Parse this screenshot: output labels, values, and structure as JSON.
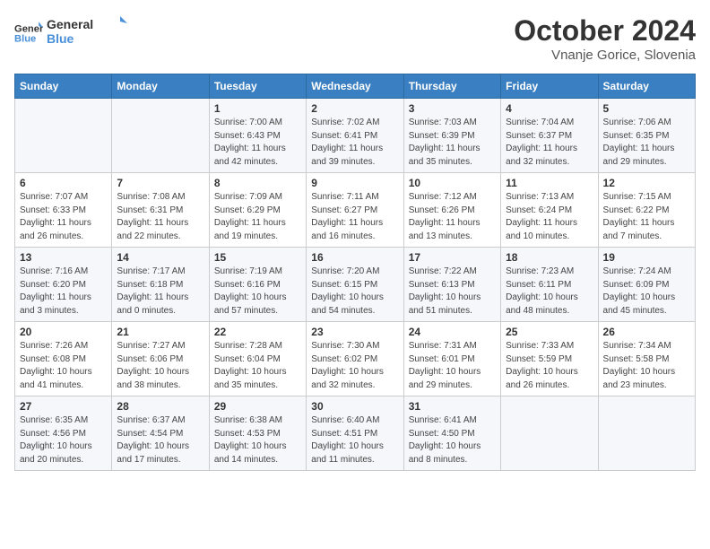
{
  "header": {
    "logo_general": "General",
    "logo_blue": "Blue",
    "month_title": "October 2024",
    "location": "Vnanje Gorice, Slovenia"
  },
  "weekdays": [
    "Sunday",
    "Monday",
    "Tuesday",
    "Wednesday",
    "Thursday",
    "Friday",
    "Saturday"
  ],
  "weeks": [
    [
      {
        "day": "",
        "info": ""
      },
      {
        "day": "",
        "info": ""
      },
      {
        "day": "1",
        "info": "Sunrise: 7:00 AM\nSunset: 6:43 PM\nDaylight: 11 hours and 42 minutes."
      },
      {
        "day": "2",
        "info": "Sunrise: 7:02 AM\nSunset: 6:41 PM\nDaylight: 11 hours and 39 minutes."
      },
      {
        "day": "3",
        "info": "Sunrise: 7:03 AM\nSunset: 6:39 PM\nDaylight: 11 hours and 35 minutes."
      },
      {
        "day": "4",
        "info": "Sunrise: 7:04 AM\nSunset: 6:37 PM\nDaylight: 11 hours and 32 minutes."
      },
      {
        "day": "5",
        "info": "Sunrise: 7:06 AM\nSunset: 6:35 PM\nDaylight: 11 hours and 29 minutes."
      }
    ],
    [
      {
        "day": "6",
        "info": "Sunrise: 7:07 AM\nSunset: 6:33 PM\nDaylight: 11 hours and 26 minutes."
      },
      {
        "day": "7",
        "info": "Sunrise: 7:08 AM\nSunset: 6:31 PM\nDaylight: 11 hours and 22 minutes."
      },
      {
        "day": "8",
        "info": "Sunrise: 7:09 AM\nSunset: 6:29 PM\nDaylight: 11 hours and 19 minutes."
      },
      {
        "day": "9",
        "info": "Sunrise: 7:11 AM\nSunset: 6:27 PM\nDaylight: 11 hours and 16 minutes."
      },
      {
        "day": "10",
        "info": "Sunrise: 7:12 AM\nSunset: 6:26 PM\nDaylight: 11 hours and 13 minutes."
      },
      {
        "day": "11",
        "info": "Sunrise: 7:13 AM\nSunset: 6:24 PM\nDaylight: 11 hours and 10 minutes."
      },
      {
        "day": "12",
        "info": "Sunrise: 7:15 AM\nSunset: 6:22 PM\nDaylight: 11 hours and 7 minutes."
      }
    ],
    [
      {
        "day": "13",
        "info": "Sunrise: 7:16 AM\nSunset: 6:20 PM\nDaylight: 11 hours and 3 minutes."
      },
      {
        "day": "14",
        "info": "Sunrise: 7:17 AM\nSunset: 6:18 PM\nDaylight: 11 hours and 0 minutes."
      },
      {
        "day": "15",
        "info": "Sunrise: 7:19 AM\nSunset: 6:16 PM\nDaylight: 10 hours and 57 minutes."
      },
      {
        "day": "16",
        "info": "Sunrise: 7:20 AM\nSunset: 6:15 PM\nDaylight: 10 hours and 54 minutes."
      },
      {
        "day": "17",
        "info": "Sunrise: 7:22 AM\nSunset: 6:13 PM\nDaylight: 10 hours and 51 minutes."
      },
      {
        "day": "18",
        "info": "Sunrise: 7:23 AM\nSunset: 6:11 PM\nDaylight: 10 hours and 48 minutes."
      },
      {
        "day": "19",
        "info": "Sunrise: 7:24 AM\nSunset: 6:09 PM\nDaylight: 10 hours and 45 minutes."
      }
    ],
    [
      {
        "day": "20",
        "info": "Sunrise: 7:26 AM\nSunset: 6:08 PM\nDaylight: 10 hours and 41 minutes."
      },
      {
        "day": "21",
        "info": "Sunrise: 7:27 AM\nSunset: 6:06 PM\nDaylight: 10 hours and 38 minutes."
      },
      {
        "day": "22",
        "info": "Sunrise: 7:28 AM\nSunset: 6:04 PM\nDaylight: 10 hours and 35 minutes."
      },
      {
        "day": "23",
        "info": "Sunrise: 7:30 AM\nSunset: 6:02 PM\nDaylight: 10 hours and 32 minutes."
      },
      {
        "day": "24",
        "info": "Sunrise: 7:31 AM\nSunset: 6:01 PM\nDaylight: 10 hours and 29 minutes."
      },
      {
        "day": "25",
        "info": "Sunrise: 7:33 AM\nSunset: 5:59 PM\nDaylight: 10 hours and 26 minutes."
      },
      {
        "day": "26",
        "info": "Sunrise: 7:34 AM\nSunset: 5:58 PM\nDaylight: 10 hours and 23 minutes."
      }
    ],
    [
      {
        "day": "27",
        "info": "Sunrise: 6:35 AM\nSunset: 4:56 PM\nDaylight: 10 hours and 20 minutes."
      },
      {
        "day": "28",
        "info": "Sunrise: 6:37 AM\nSunset: 4:54 PM\nDaylight: 10 hours and 17 minutes."
      },
      {
        "day": "29",
        "info": "Sunrise: 6:38 AM\nSunset: 4:53 PM\nDaylight: 10 hours and 14 minutes."
      },
      {
        "day": "30",
        "info": "Sunrise: 6:40 AM\nSunset: 4:51 PM\nDaylight: 10 hours and 11 minutes."
      },
      {
        "day": "31",
        "info": "Sunrise: 6:41 AM\nSunset: 4:50 PM\nDaylight: 10 hours and 8 minutes."
      },
      {
        "day": "",
        "info": ""
      },
      {
        "day": "",
        "info": ""
      }
    ]
  ]
}
